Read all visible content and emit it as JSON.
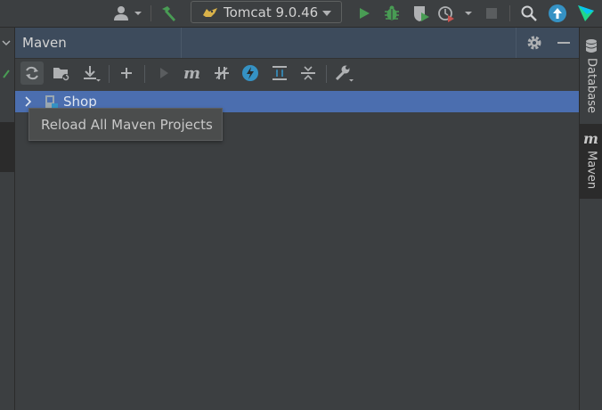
{
  "topbar": {
    "run_config_label": "Tomcat 9.0.46"
  },
  "panel": {
    "title": "Maven"
  },
  "tree": {
    "project_name": "Shop"
  },
  "tooltip": {
    "text": "Reload All Maven Projects"
  },
  "right_strip": {
    "database_label": "Database",
    "maven_label": "Maven"
  },
  "colors": {
    "background": "#3c3f41",
    "panel_header": "#3d4b5c",
    "selection": "#4b6eaf",
    "run_green": "#499c54",
    "update_blue": "#3592c4"
  }
}
